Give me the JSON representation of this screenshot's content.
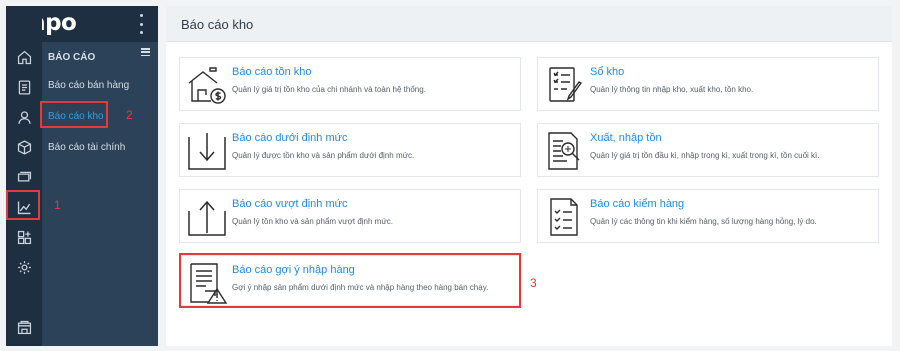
{
  "brand": {
    "logo_text": "Sapo"
  },
  "sidebar": {
    "header": "BÁO CÁO",
    "items": [
      {
        "label": "Báo cáo bán hàng",
        "active": false
      },
      {
        "label": "Báo cáo kho",
        "active": true
      },
      {
        "label": "Báo cáo tài chính",
        "active": false
      }
    ]
  },
  "rail_icons": [
    "home-icon",
    "orders-icon",
    "customer-icon",
    "product-box-icon",
    "shipping-icon",
    "report-chart-icon",
    "apps-add-icon",
    "settings-gear-icon",
    "store-icon"
  ],
  "page": {
    "title": "Báo cáo kho"
  },
  "cards": [
    {
      "title": "Báo cáo tồn kho",
      "desc": "Quản lý giá trị tồn kho của chi nhánh và toàn hệ thống.",
      "icon": "warehouse-money-icon"
    },
    {
      "title": "Sổ kho",
      "desc": "Quản lý thông tin nhập kho, xuất kho, tồn kho.",
      "icon": "ledger-edit-icon"
    },
    {
      "title": "Báo cáo dưới định mức",
      "desc": "Quản lý được tồn kho và sản phẩm dưới định mức.",
      "icon": "arrow-down-box-icon"
    },
    {
      "title": "Xuất, nhập tồn",
      "desc": "Quản lý giá trị tồn đầu kì, nhập trong kì, xuất trong kì, tồn cuối kì.",
      "icon": "document-search-icon"
    },
    {
      "title": "Báo cáo vượt định mức",
      "desc": "Quản lý tồn kho và sản phẩm vượt định mức.",
      "icon": "arrow-up-box-icon"
    },
    {
      "title": "Báo cáo kiểm hàng",
      "desc": "Quản lý các thông tin khi kiểm hàng, số lượng hàng hỏng, lý do.",
      "icon": "checklist-icon"
    },
    {
      "title": "Báo cáo gợi ý nhập hàng",
      "desc": "Gợi ý nhập sản phẩm dưới định mức và nhập hàng theo hàng bán chạy.",
      "icon": "document-warning-icon"
    }
  ],
  "annotations": {
    "one": "1",
    "two": "2",
    "three": "3"
  },
  "colors": {
    "rail": "#1e2f41",
    "submenu": "#2c4259",
    "accent": "#1f8be0",
    "highlight": "#e33b3b"
  }
}
